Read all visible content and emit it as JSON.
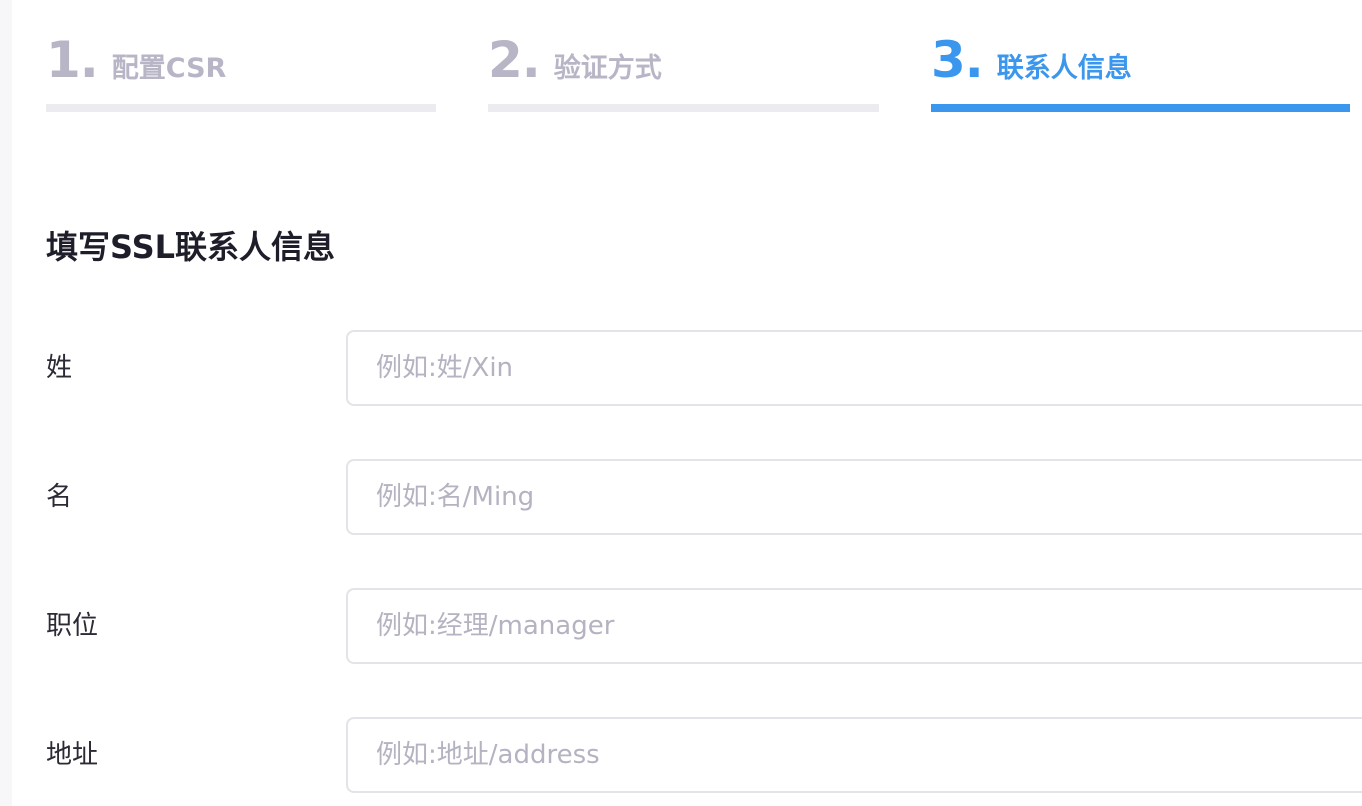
{
  "steps": [
    {
      "number": "1.",
      "label": "配置CSR",
      "state": "inactive"
    },
    {
      "number": "2.",
      "label": "验证方式",
      "state": "inactive"
    },
    {
      "number": "3.",
      "label": "联系人信息",
      "state": "active"
    }
  ],
  "section_title": "填写SSL联系人信息",
  "form": {
    "last_name": {
      "label": "姓",
      "placeholder": "例如:姓/Xin",
      "value": ""
    },
    "first_name": {
      "label": "名",
      "placeholder": "例如:名/Ming",
      "value": ""
    },
    "position": {
      "label": "职位",
      "placeholder": "例如:经理/manager",
      "value": ""
    },
    "address": {
      "label": "地址",
      "placeholder": "例如:地址/address",
      "value": ""
    }
  },
  "colors": {
    "accent": "#3b97ee",
    "inactive_text": "#b7b5c6",
    "inactive_bar": "#ebebf0",
    "input_border": "#e3e3ea",
    "placeholder": "#b3b3c2"
  }
}
